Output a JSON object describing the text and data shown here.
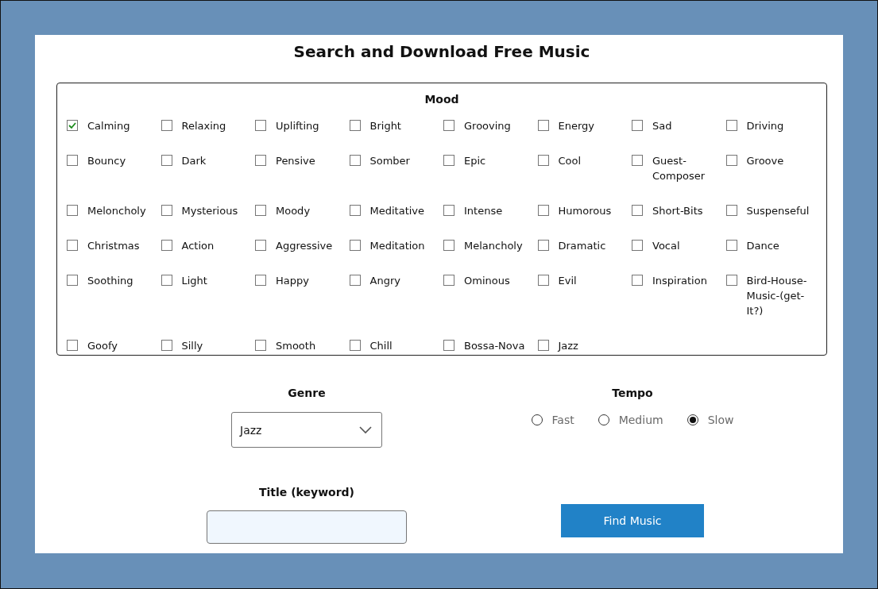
{
  "title": "Search and Download Free Music",
  "mood": {
    "legend": "Mood",
    "options": [
      {
        "label": "Calming",
        "checked": true
      },
      {
        "label": "Relaxing",
        "checked": false
      },
      {
        "label": "Uplifting",
        "checked": false
      },
      {
        "label": "Bright",
        "checked": false
      },
      {
        "label": "Grooving",
        "checked": false
      },
      {
        "label": "Energy",
        "checked": false
      },
      {
        "label": "Sad",
        "checked": false
      },
      {
        "label": "Driving",
        "checked": false
      },
      {
        "label": "Bouncy",
        "checked": false
      },
      {
        "label": "Dark",
        "checked": false
      },
      {
        "label": "Pensive",
        "checked": false
      },
      {
        "label": "Somber",
        "checked": false
      },
      {
        "label": "Epic",
        "checked": false
      },
      {
        "label": "Cool",
        "checked": false
      },
      {
        "label": "Guest-Composer",
        "checked": false
      },
      {
        "label": "Groove",
        "checked": false
      },
      {
        "label": "Meloncholy",
        "checked": false
      },
      {
        "label": "Mysterious",
        "checked": false
      },
      {
        "label": "Moody",
        "checked": false
      },
      {
        "label": "Meditative",
        "checked": false
      },
      {
        "label": "Intense",
        "checked": false
      },
      {
        "label": "Humorous",
        "checked": false
      },
      {
        "label": "Short-Bits",
        "checked": false
      },
      {
        "label": "Suspenseful",
        "checked": false
      },
      {
        "label": "Christmas",
        "checked": false
      },
      {
        "label": "Action",
        "checked": false
      },
      {
        "label": "Aggressive",
        "checked": false
      },
      {
        "label": "Meditation",
        "checked": false
      },
      {
        "label": "Melancholy",
        "checked": false
      },
      {
        "label": "Dramatic",
        "checked": false
      },
      {
        "label": "Vocal",
        "checked": false
      },
      {
        "label": "Dance",
        "checked": false
      },
      {
        "label": "Soothing",
        "checked": false
      },
      {
        "label": "Light",
        "checked": false
      },
      {
        "label": "Happy",
        "checked": false
      },
      {
        "label": "Angry",
        "checked": false
      },
      {
        "label": "Ominous",
        "checked": false
      },
      {
        "label": "Evil",
        "checked": false
      },
      {
        "label": "Inspiration",
        "checked": false
      },
      {
        "label": "Bird-House-Music-(get-It?)",
        "checked": false
      },
      {
        "label": "Goofy",
        "checked": false
      },
      {
        "label": "Silly",
        "checked": false
      },
      {
        "label": "Smooth",
        "checked": false
      },
      {
        "label": "Chill",
        "checked": false
      },
      {
        "label": "Bossa-Nova",
        "checked": false
      },
      {
        "label": "Jazz",
        "checked": false
      }
    ]
  },
  "genre": {
    "label": "Genre",
    "value": "Jazz"
  },
  "tempo": {
    "label": "Tempo",
    "options": [
      {
        "label": "Fast",
        "selected": false
      },
      {
        "label": "Medium",
        "selected": false
      },
      {
        "label": "Slow",
        "selected": true
      }
    ]
  },
  "keyword": {
    "label": "Title (keyword)"
  },
  "button": "Find Music"
}
